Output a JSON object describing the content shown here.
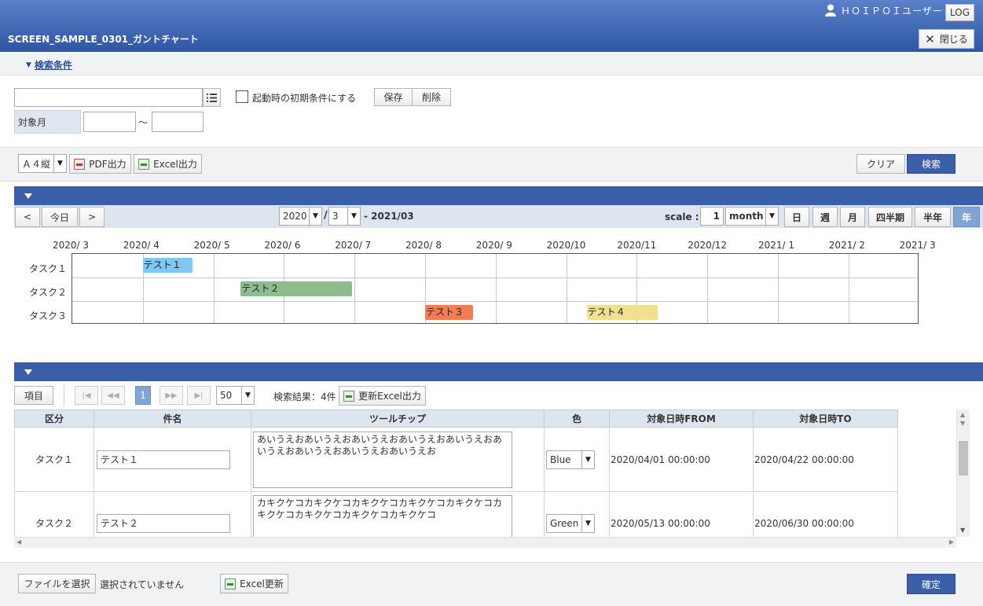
{
  "header": {
    "title": "SCREEN_SAMPLE_0301_ガントチャート",
    "user": "ＨＯＩＰＯＩユーザー",
    "log_label": "LOG",
    "close_label": "閉じる"
  },
  "search": {
    "toggle_label": "検索条件",
    "save_label": "保存",
    "delete_label": "削除",
    "initial_condition_label": "起動時の初期条件にする",
    "target_month_label": "対象月",
    "range_sep": "～"
  },
  "toolbar": {
    "paper_select": "Ａ４縦",
    "pdf_label": "PDF出力",
    "excel_label": "Excel出力",
    "clear_label": "クリア",
    "search_label": "検索"
  },
  "gantt": {
    "prev_label": "<",
    "today_label": "今日",
    "next_label": ">",
    "year_select": "2020",
    "month_sep": "/",
    "month_select": "3",
    "range_end": "- 2021/03",
    "scale_label": "scale :",
    "scale_value": "1",
    "scale_unit": "month",
    "views": [
      "日",
      "週",
      "月",
      "四半期",
      "半年",
      "年"
    ],
    "active_view": "年",
    "months": [
      "2020/ 3",
      "2020/ 4",
      "2020/ 5",
      "2020/ 6",
      "2020/ 7",
      "2020/ 8",
      "2020/ 9",
      "2020/10",
      "2020/11",
      "2020/12",
      "2021/ 1",
      "2021/ 2",
      "2021/ 3"
    ],
    "rows": [
      "タスク１",
      "タスク２",
      "タスク３"
    ],
    "tasks": [
      {
        "label": "テスト１",
        "row": 0,
        "start": "2020-04-01",
        "end": "2020-04-22",
        "color": "#7ec8f2"
      },
      {
        "label": "テスト２",
        "row": 1,
        "start": "2020-05-13",
        "end": "2020-06-30",
        "color": "#8fbc8f"
      },
      {
        "label": "テスト３",
        "row": 2,
        "start": "2020-08-01",
        "end": "2020-08-22",
        "color": "#f47c52"
      },
      {
        "label": "テスト４",
        "row": 2,
        "start": "2020-10-10",
        "end": "2020-11-10",
        "color": "#efe18f"
      }
    ]
  },
  "list": {
    "columns_label": "項目",
    "current_page": "1",
    "page_size": "50",
    "result_text": "検索結果：4件",
    "update_excel_label": "更新Excel出力",
    "headers": [
      "区分",
      "件名",
      "ツールチップ",
      "色",
      "対象日時FROM",
      "対象日時TO"
    ],
    "rows": [
      {
        "kubun": "タスク１",
        "name": "テスト１",
        "tooltip": "あいうえおあいうえおあいうえおあいうえおあいうえおあいうえおあいうえおあいうえおあいうえお",
        "color": "Blue",
        "from": "2020/04/01 00:00:00",
        "to": "2020/04/22 00:00:00"
      },
      {
        "kubun": "タスク２",
        "name": "テスト２",
        "tooltip": "カキクケコカキクケコカキクケコカキクケコカキクケコカキクケコカキクケコカキクケコカキクケコ",
        "color": "Green",
        "from": "2020/05/13 00:00:00",
        "to": "2020/06/30 00:00:00"
      }
    ]
  },
  "footer": {
    "file_select_label": "ファイルを選択",
    "file_status": "選択されていません",
    "excel_update_label": "Excel更新",
    "confirm_label": "確定"
  }
}
